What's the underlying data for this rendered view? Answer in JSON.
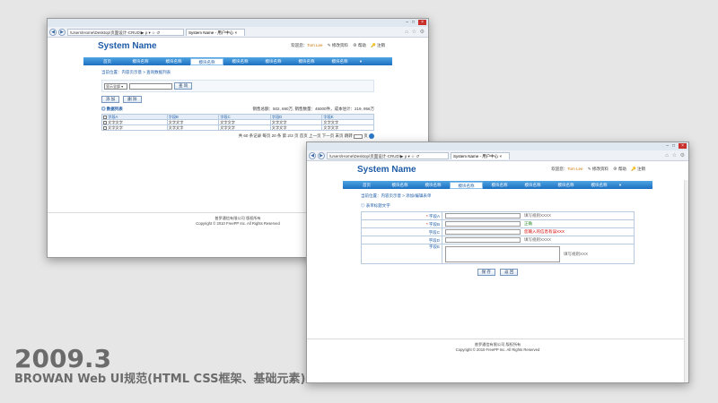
{
  "caption": {
    "year": "2009.3",
    "subtitle": "BROWAN Web UI规范(HTML CSS框架、基础元素)"
  },
  "browser": {
    "url": "\\Users\\Home\\Desktop\\页面设计-CRUD\\▶ ρ ▾ ☆ ↺",
    "tab_title": "System Name - 用户中心",
    "tab_close": "×",
    "controls": [
      "–",
      "□",
      "×"
    ],
    "fav_icons": "⌂ ☆ ⚙"
  },
  "app": {
    "name": "System Name",
    "user_greeting": "欢迎您：",
    "user_name": "Tom Lee",
    "link_profile": "修改资料",
    "link_help": "帮助",
    "link_logout": "注销",
    "nav": [
      "首页",
      "模块名称",
      "模块名称",
      "模块名称",
      "模块名称",
      "模块名称",
      "模块名称",
      "模块名称",
      "▾"
    ],
    "footer_line1": "普罗通信有限公司 版权所有",
    "footer_line2": "Copyright © 2010 FreePP Inc. All Rights Reserved"
  },
  "window1": {
    "breadcrumb": "当前位置：内容页示意 > 查询数据列表",
    "search_select": "显示全部",
    "search_button": "查 询",
    "add_button": "添 加",
    "delete_button": "删 除",
    "list_title": "数据列表",
    "summary": "销售总额：502, 690万, 销售数量：45000件，成本估计：219, 956万",
    "columns": [
      "字段A",
      "字段B",
      "字段C",
      "字段D",
      "字段E"
    ],
    "rows": [
      [
        "文字文字",
        "文字文字",
        "文字文字",
        "文字文字",
        "文字文字"
      ],
      [
        "文字文字",
        "文字文字",
        "文字文字",
        "文字文字",
        "文字文字"
      ]
    ],
    "pager": "共 60 条记录  每页 20 条  第 2/3 页  首页 上一页 下一页 末页  跳转",
    "pager_unit": "页"
  },
  "window2": {
    "breadcrumb": "当前位置：内容页示意 > 添加/编辑表单",
    "form_title": "表单标题文字",
    "fields": [
      {
        "label": "字段A",
        "required": true,
        "hint": "填写规则XXXX",
        "hint_type": "normal"
      },
      {
        "label": "字段B",
        "required": true,
        "hint": "正确",
        "hint_type": "ok"
      },
      {
        "label": "字段C",
        "required": false,
        "hint": "您输入的信息有误XXX",
        "hint_type": "err"
      },
      {
        "label": "字段D",
        "required": false,
        "hint": "填写规则XXXX",
        "hint_type": "normal"
      }
    ],
    "textarea_label": "字段E",
    "textarea_hint": "填写规则XXX",
    "required_mark": "*",
    "save_button": "保 存",
    "back_button": "返 回"
  }
}
